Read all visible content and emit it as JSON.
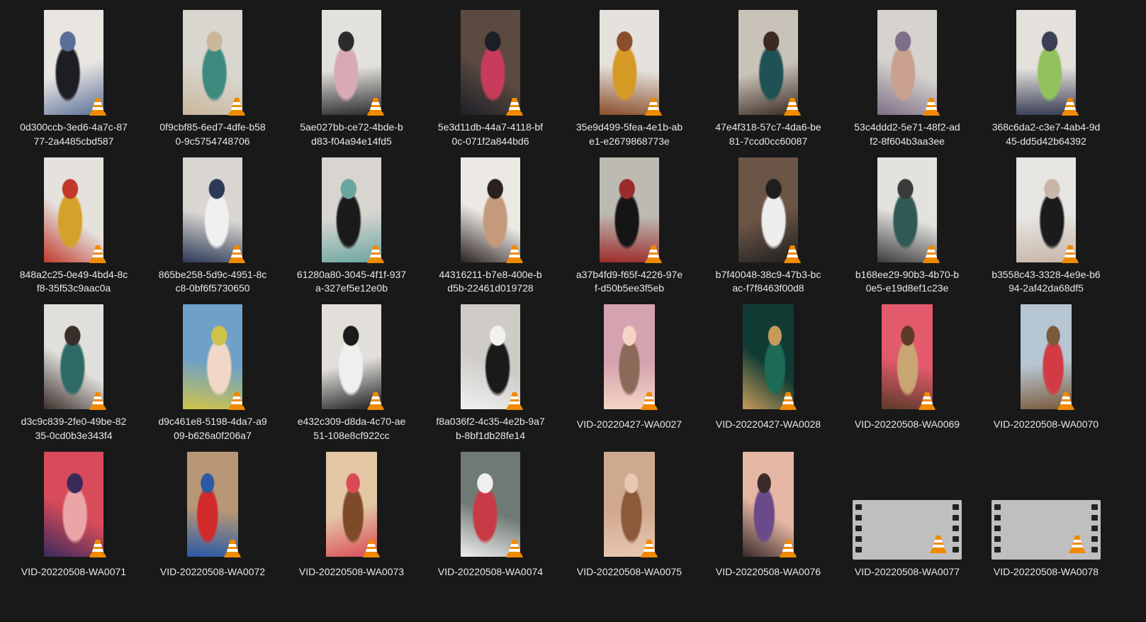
{
  "files": [
    {
      "line1": "0d300ccb-3ed6-4a7c-87",
      "line2": "77-2a4485cbd587",
      "kind": "portrait",
      "palette": [
        "#e9e6e2",
        "#1d1d24",
        "#5a6f98"
      ]
    },
    {
      "line1": "0f9cbf85-6ed7-4dfe-b58",
      "line2": "0-9c5754748706",
      "kind": "portrait",
      "palette": [
        "#d9d6d0",
        "#3e8a7f",
        "#c9b89c"
      ]
    },
    {
      "line1": "5ae027bb-ce72-4bde-b",
      "line2": "d83-f04a94e14fd5",
      "kind": "portrait",
      "palette": [
        "#e3e1dd",
        "#d7aab6",
        "#2b2b2b"
      ]
    },
    {
      "line1": "5e3d11db-44a7-4118-bf",
      "line2": "0c-071f2a844bd6",
      "kind": "portrait",
      "palette": [
        "#5b4a40",
        "#c73c5b",
        "#1d1f26"
      ]
    },
    {
      "line1": "35e9d499-5fea-4e1b-ab",
      "line2": "e1-e2679868773e",
      "kind": "portrait",
      "palette": [
        "#e5e2de",
        "#d59a26",
        "#8a4e2a"
      ]
    },
    {
      "line1": "47e4f318-57c7-4da6-be",
      "line2": "81-7ccd0cc60087",
      "kind": "portrait",
      "palette": [
        "#c9c2b8",
        "#1f5255",
        "#3a2a22"
      ]
    },
    {
      "line1": "53c4ddd2-5e71-48f2-ad",
      "line2": "f2-8f604b3aa3ee",
      "kind": "portrait",
      "palette": [
        "#d6d3cf",
        "#c9a08e",
        "#7d6f87"
      ]
    },
    {
      "line1": "368c6da2-c3e7-4ab4-9d",
      "line2": "45-dd5d42b64392",
      "kind": "portrait",
      "palette": [
        "#e4e1dd",
        "#91c25d",
        "#3a3f55"
      ]
    },
    {
      "line1": "848a2c25-0e49-4bd4-8c",
      "line2": "f8-35f53c9aac0a",
      "kind": "portrait",
      "palette": [
        "#e5e2de",
        "#d4a12a",
        "#c0392b"
      ]
    },
    {
      "line1": "865be258-5d9c-4951-8c",
      "line2": "c8-0bf6f5730650",
      "kind": "portrait",
      "palette": [
        "#d9d6d1",
        "#f0f0f0",
        "#2c3a57"
      ]
    },
    {
      "line1": "61280a80-3045-4f1f-937",
      "line2": "a-327ef5e12e0b",
      "kind": "portrait",
      "palette": [
        "#d8d5d0",
        "#1a1a1a",
        "#6aa6a0"
      ]
    },
    {
      "line1": "44316211-b7e8-400e-b",
      "line2": "d5b-22461d019728",
      "kind": "portrait",
      "palette": [
        "#ece9e5",
        "#c59a7c",
        "#2a2020"
      ]
    },
    {
      "line1": "a37b4fd9-f65f-4226-97e",
      "line2": "f-d50b5ee3f5eb",
      "kind": "portrait",
      "palette": [
        "#bdb9b3",
        "#151515",
        "#9c2b2b"
      ]
    },
    {
      "line1": "b7f40048-38c9-47b3-bc",
      "line2": "ac-f7f8463f00d8",
      "kind": "portrait",
      "palette": [
        "#6a5546",
        "#eeeeee",
        "#1e1e1e"
      ]
    },
    {
      "line1": "b168ee29-90b3-4b70-b",
      "line2": "0e5-e19d8ef1c23e",
      "kind": "portrait",
      "palette": [
        "#e4e2de",
        "#2f5a55",
        "#3b3b3b"
      ]
    },
    {
      "line1": "b3558c43-3328-4e9e-b6",
      "line2": "94-2af42da68df5",
      "kind": "portrait",
      "palette": [
        "#e7e5e2",
        "#1b1b1b",
        "#c8b6a8"
      ]
    },
    {
      "line1": "d3c9c839-2fe0-49be-82",
      "line2": "35-0cd0b3e343f4",
      "kind": "portrait",
      "palette": [
        "#e1dfdb",
        "#2e6b66",
        "#3a2e2a"
      ]
    },
    {
      "line1": "d9c461e8-5198-4da7-a9",
      "line2": "09-b626a0f206a7",
      "kind": "portrait",
      "palette": [
        "#6ea0c8",
        "#f2d7c7",
        "#cfc34a"
      ]
    },
    {
      "line1": "e432c309-d8da-4c70-ae",
      "line2": "51-108e8cf922cc",
      "kind": "portrait",
      "palette": [
        "#e2dfdb",
        "#efefef",
        "#1b1b1b"
      ]
    },
    {
      "line1": "f8a036f2-4c35-4e2b-9a7",
      "line2": "b-8bf1db28fe14",
      "kind": "portrait",
      "palette": [
        "#cfccc8",
        "#1a1a1a",
        "#f1f1f1"
      ]
    },
    {
      "line1": "VID-20220427-WA0027",
      "line2": "",
      "kind": "narrow",
      "palette": [
        "#d5a3b0",
        "#8b6a5a",
        "#f4d4c3"
      ]
    },
    {
      "line1": "VID-20220427-WA0028",
      "line2": "",
      "kind": "narrow",
      "palette": [
        "#0f3b33",
        "#1d6a57",
        "#c79a5a"
      ]
    },
    {
      "line1": "VID-20220508-WA0069",
      "line2": "",
      "kind": "narrow",
      "palette": [
        "#e35a6c",
        "#c9a573",
        "#5b3a2a"
      ]
    },
    {
      "line1": "VID-20220508-WA0070",
      "line2": "",
      "kind": "narrow",
      "palette": [
        "#b7c6d3",
        "#d23b45",
        "#7a5a3a"
      ]
    },
    {
      "line1": "VID-20220508-WA0071",
      "line2": "",
      "kind": "portrait",
      "palette": [
        "#d84b5a",
        "#eaa6a7",
        "#3a2a5a"
      ]
    },
    {
      "line1": "VID-20220508-WA0072",
      "line2": "",
      "kind": "narrow",
      "palette": [
        "#b89776",
        "#d12a2a",
        "#2a5aa5"
      ]
    },
    {
      "line1": "VID-20220508-WA0073",
      "line2": "",
      "kind": "narrow",
      "palette": [
        "#e3c6a4",
        "#7d4a2a",
        "#d94a55"
      ]
    },
    {
      "line1": "VID-20220508-WA0074",
      "line2": "",
      "kind": "portrait",
      "palette": [
        "#6f7a74",
        "#c83a45",
        "#efefef"
      ]
    },
    {
      "line1": "VID-20220508-WA0075",
      "line2": "",
      "kind": "narrow",
      "palette": [
        "#cfa98f",
        "#8a5a3a",
        "#e8c7b0"
      ]
    },
    {
      "line1": "VID-20220508-WA0076",
      "line2": "",
      "kind": "narrow",
      "palette": [
        "#e6b6a4",
        "#6a4a8a",
        "#3a2a2a"
      ]
    },
    {
      "line1": "VID-20220508-WA0077",
      "line2": "",
      "kind": "film",
      "palette": [
        "#5a5a5a",
        "#e23a4a",
        "#f1d24a"
      ]
    },
    {
      "line1": "VID-20220508-WA0078",
      "line2": "",
      "kind": "film",
      "palette": [
        "#3a5a8a",
        "#d9c23a",
        "#c0302a"
      ]
    }
  ],
  "badge_icon": "vlc-cone-icon",
  "colors": {
    "background": "#191919",
    "label": "#e8e8e8",
    "cone_orange": "#f08a00",
    "cone_white": "#ffffff"
  }
}
